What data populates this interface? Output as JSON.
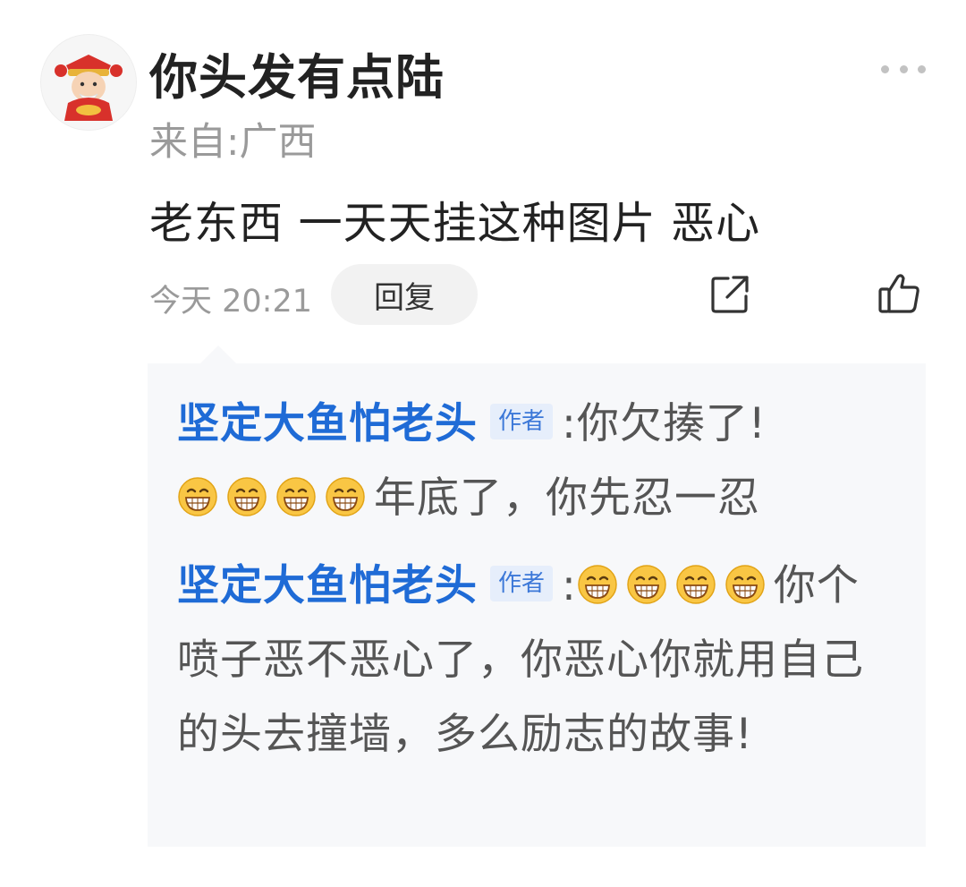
{
  "comment": {
    "username": "你头发有点陆",
    "location": "来自:广西",
    "text": "老东西 一天天挂这种图片 恶心",
    "time": "今天 20:21",
    "reply_button": "回复"
  },
  "replies": [
    {
      "author": "坚定大鱼怕老头",
      "badge": "作者",
      "separator": ":",
      "text_before": "你欠揍了!",
      "emoji_count": 4,
      "text_after": "年底了，你先忍一忍"
    },
    {
      "author": "坚定大鱼怕老头",
      "badge": "作者",
      "separator": ":",
      "emoji_count": 4,
      "text_after": "你个喷子恶不恶心了，你恶心你就用自己的头去撞墙，多么励志的故事!"
    }
  ],
  "icons": {
    "avatar": "god-of-wealth-avatar",
    "more": "more-dots-icon",
    "share": "share-icon",
    "like": "thumbs-up-icon",
    "emoji": "grinning-face-emoji"
  },
  "colors": {
    "author_name": "#1f6bd6",
    "badge_bg": "#e6eefb",
    "reply_bg": "#f7f8fa",
    "secondary_text": "#9a9a9a"
  }
}
